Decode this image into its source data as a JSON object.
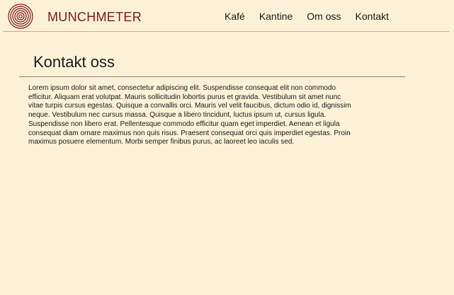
{
  "header": {
    "brand": "MUNCHMETER",
    "nav": [
      {
        "label": "Kafé"
      },
      {
        "label": "Kantine"
      },
      {
        "label": "Om oss"
      },
      {
        "label": "Kontakt"
      }
    ]
  },
  "main": {
    "title": "Kontakt oss",
    "body": "Lorem ipsum dolor sit amet, consectetur adipiscing elit. Suspendisse consequat elit non commodo efficitur. Aliquam erat volutpat. Mauris sollicitudin lobortis purus et gravida. Vestibulum sit amet nunc vitae turpis cursus egestas. Quisque a convallis orci. Mauris vel velit faucibus, dictum odio id, dignissim neque. Vestibulum nec cursus massa. Quisque a libero tincidunt, luctus ipsum ut, cursus ligula. Suspendisse non libero erat. Pellentesque commodo efficitur quam eget imperdiet. Aenean et ligula consequat diam ornare maximus non quis risus. Praesent consequat orci quis imperdiet egestas. Proin maximus posuere elementum. Morbi semper finibus purus, ac laoreet leo iaculis sed."
  },
  "colors": {
    "background": "#fdf1d8",
    "brand": "#7a1b14",
    "header_line": "#c9a89a",
    "title_line": "#8c8478",
    "text": "#1a1a1a"
  },
  "icons": {
    "logo": "concentric-circles-logo-icon"
  }
}
